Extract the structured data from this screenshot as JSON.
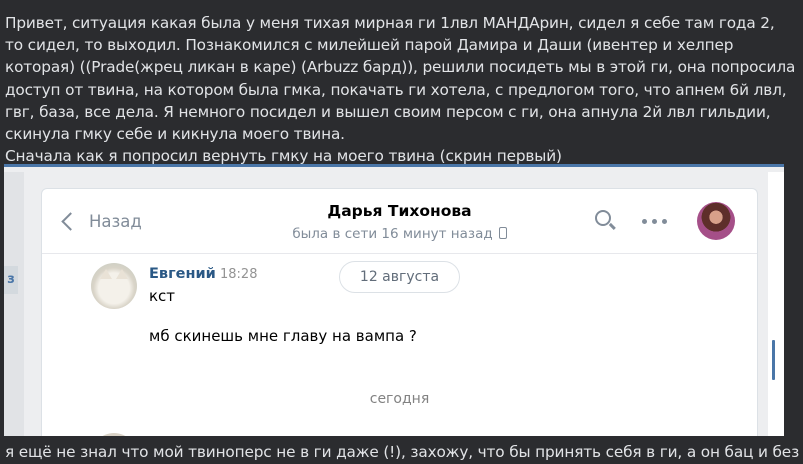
{
  "post": {
    "paragraphs": [
      "Привет, ситуация какая была у меня тихая мирная ги 1лвл МАНДАрин, сидел я себе там года 2, то сидел, то выходил. Познакомился с милейшей парой Дамира и Даши (ивентер и хелпер которая) ((Prade(жрец ликан в каре) (Arbuzz бард)), решили посидеть мы в этой ги, она попросила доступ от твина, на котором была гмка, покачать ги хотела, с предлогом того, что апнем 6й лвл, гвг, база, все дела. Я немного посидел и вышел своим персом с ги, она апнула 2й лвл гильдии, скинула гмку себе и кикнула моего твина.",
      "Сначала как я попросил вернуть гмку на моего твина (скрин первый)"
    ],
    "continuation": "я ещё не знал что мой твиноперс не в ги даже (!), захожу, что бы принять себя в ги, а он бац и без"
  },
  "screenshot": {
    "side_tab": "з",
    "header": {
      "back_label": "Назад",
      "peer_name": "Дарья Тихонова",
      "peer_status": "была в сети 16 минут назад"
    },
    "message": {
      "sender": "Евгений",
      "time": "18:28",
      "date_label": "12 августа",
      "lines": [
        "кст",
        "мб скинешь мне главу на вампа ?"
      ]
    },
    "today_label": "сегодня"
  },
  "icons": [
    "chevron-left-icon",
    "phone-icon",
    "search-icon",
    "more-icon"
  ],
  "colors": {
    "page_bg": "#2b2c2f",
    "post_text": "#e1e3e6",
    "vk_blue": "#4a76a8",
    "link": "#2a5885",
    "muted": "#818c99"
  }
}
